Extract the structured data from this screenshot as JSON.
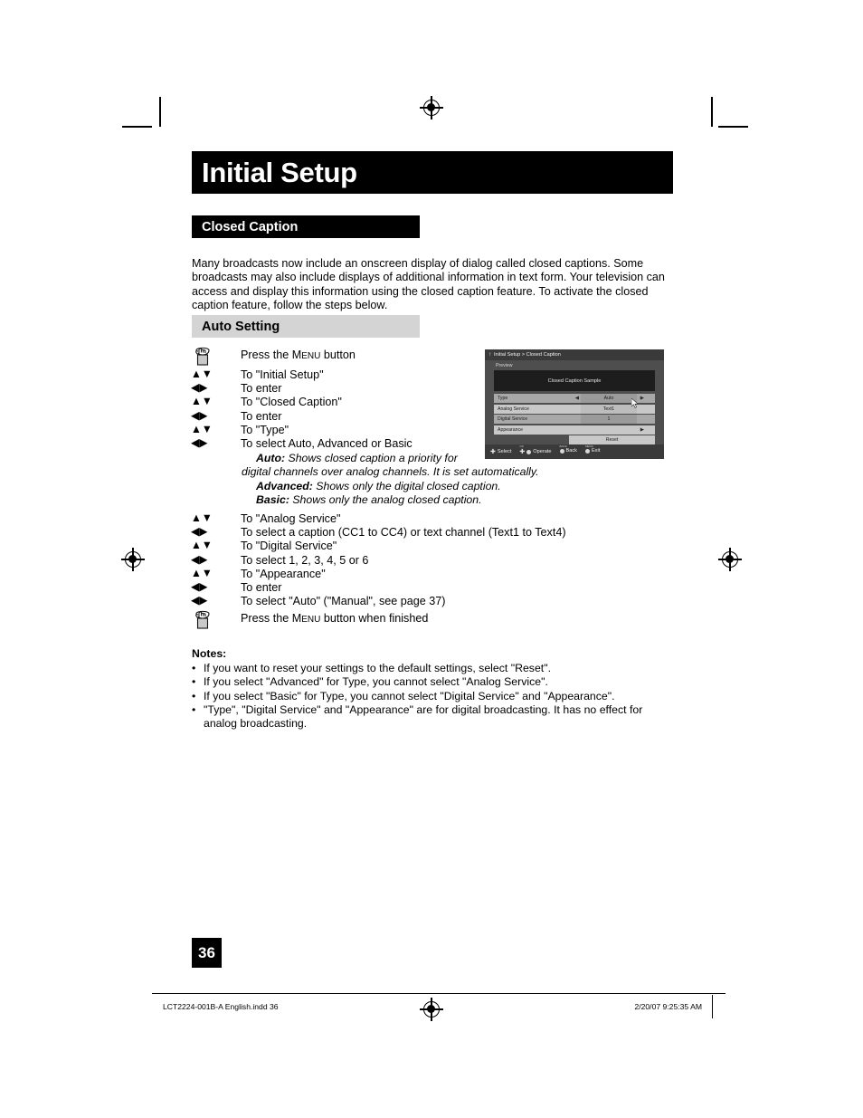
{
  "page": {
    "title": "Initial Setup",
    "number": "36"
  },
  "sections": {
    "closed_caption": {
      "heading": "Closed Caption",
      "intro": "Many broadcasts now include an onscreen display of dialog called closed captions. Some broadcasts may also include displays of additional information in text form. Your television can access and display this information using the closed caption feature. To activate the closed caption feature, follow the steps below."
    },
    "auto_setting": {
      "heading": "Auto Setting"
    }
  },
  "steps_group1": [
    {
      "icon": "hand-press-icon",
      "glyph": "",
      "text_pre": "Press the ",
      "smallcaps": "Menu",
      "text_post": " button"
    },
    {
      "icon": "up-down-arrows-icon",
      "glyph": "▲▼",
      "text_pre": "To \"Initial Setup\"",
      "smallcaps": "",
      "text_post": ""
    },
    {
      "icon": "left-right-arrows-icon",
      "glyph": "◀▶",
      "text_pre": "To enter",
      "smallcaps": "",
      "text_post": ""
    },
    {
      "icon": "up-down-arrows-icon",
      "glyph": "▲▼",
      "text_pre": "To \"Closed Caption\"",
      "smallcaps": "",
      "text_post": ""
    },
    {
      "icon": "left-right-arrows-icon",
      "glyph": "◀▶",
      "text_pre": "To enter",
      "smallcaps": "",
      "text_post": ""
    },
    {
      "icon": "up-down-arrows-icon",
      "glyph": "▲▼",
      "text_pre": "To \"Type\"",
      "smallcaps": "",
      "text_post": ""
    },
    {
      "icon": "left-right-arrows-icon",
      "glyph": "◀▶",
      "text_pre": "To select Auto, Advanced or Basic",
      "smallcaps": "",
      "text_post": ""
    }
  ],
  "type_descriptions": [
    {
      "term": "Auto:",
      "line1": " Shows closed caption a priority for",
      "line2": "digital channels over analog channels.  It is set automatically."
    },
    {
      "term": "Advanced:",
      "line1": " Shows only the digital closed caption.",
      "line2": ""
    },
    {
      "term": "Basic:",
      "line1": " Shows only the analog closed caption.",
      "line2": ""
    }
  ],
  "steps_group2": [
    {
      "icon": "up-down-arrows-icon",
      "glyph": "▲▼",
      "text_pre": "To \"Analog Service\"",
      "smallcaps": "",
      "text_post": ""
    },
    {
      "icon": "left-right-arrows-icon",
      "glyph": "◀▶",
      "text_pre": "To select a caption (CC1 to CC4) or text channel (Text1 to Text4)",
      "smallcaps": "",
      "text_post": ""
    },
    {
      "icon": "up-down-arrows-icon",
      "glyph": "▲▼",
      "text_pre": "To \"Digital Service\"",
      "smallcaps": "",
      "text_post": ""
    },
    {
      "icon": "left-right-arrows-icon",
      "glyph": "◀▶",
      "text_pre": "To select 1, 2, 3, 4, 5 or 6",
      "smallcaps": "",
      "text_post": ""
    },
    {
      "icon": "up-down-arrows-icon",
      "glyph": "▲▼",
      "text_pre": "To \"Appearance\"",
      "smallcaps": "",
      "text_post": ""
    },
    {
      "icon": "left-right-arrows-icon",
      "glyph": "◀▶",
      "text_pre": "To enter",
      "smallcaps": "",
      "text_post": ""
    },
    {
      "icon": "left-right-arrows-icon",
      "glyph": "◀▶",
      "text_pre": "To select \"Auto\" (\"Manual\", see page 37)",
      "smallcaps": "",
      "text_post": ""
    },
    {
      "icon": "hand-press-icon",
      "glyph": "",
      "text_pre": "Press the ",
      "smallcaps": "Menu",
      "text_post": " button when finished"
    }
  ],
  "notes": {
    "heading": "Notes:",
    "bullet": "•",
    "items": [
      {
        "line1": "If you want to reset your settings to the default settings, select \"Reset\".",
        "line2": ""
      },
      {
        "line1": "If you select \"Advanced\" for Type, you cannot select \"Analog Service\".",
        "line2": ""
      },
      {
        "line1": "If you select \"Basic\" for Type, you cannot select \"Digital Service\" and \"Appearance\".",
        "line2": ""
      },
      {
        "line1": "\"Type\", \"Digital Service\" and \"Appearance\" are for digital broadcasting.  It has no effect for",
        "line2": "analog broadcasting."
      }
    ]
  },
  "osd": {
    "header_arrow": "↑",
    "header_title": "Initial Setup > Closed Caption",
    "preview_label": "Preview",
    "sample_text": "Closed Caption Sample",
    "rows": [
      {
        "name": "Type",
        "value": "Auto",
        "left_arrow": "◀",
        "right_arrow": "▶",
        "state": "selected"
      },
      {
        "name": "Analog Service",
        "value": "Text1",
        "left_arrow": "",
        "right_arrow": "",
        "state": "plain"
      },
      {
        "name": "Digital Service",
        "value": "1",
        "left_arrow": "",
        "right_arrow": "",
        "state": "selected"
      },
      {
        "name": "Appearance",
        "value": "",
        "left_arrow": "",
        "right_arrow": "▶",
        "state": "plain"
      }
    ],
    "reset_label": "Reset",
    "footer": [
      {
        "minicap": "",
        "glyph": "✚",
        "has_dot": false,
        "label": "Select"
      },
      {
        "minicap": "OK",
        "glyph": "✚",
        "has_dot": true,
        "label": "Operate"
      },
      {
        "minicap": "BACK",
        "glyph": "",
        "has_dot": true,
        "label": "Back"
      },
      {
        "minicap": "MENU",
        "glyph": "",
        "has_dot": true,
        "label": "Exit"
      }
    ]
  },
  "footer": {
    "left": "LCT2224-001B-A English.indd   36",
    "right": "2/20/07   9:25:35 AM"
  },
  "colors": {
    "banner_black": "#000000",
    "section_grey": "#d4d4d4",
    "osd_bg": "#4e4e4e",
    "osd_header": "#3a3a3a"
  }
}
